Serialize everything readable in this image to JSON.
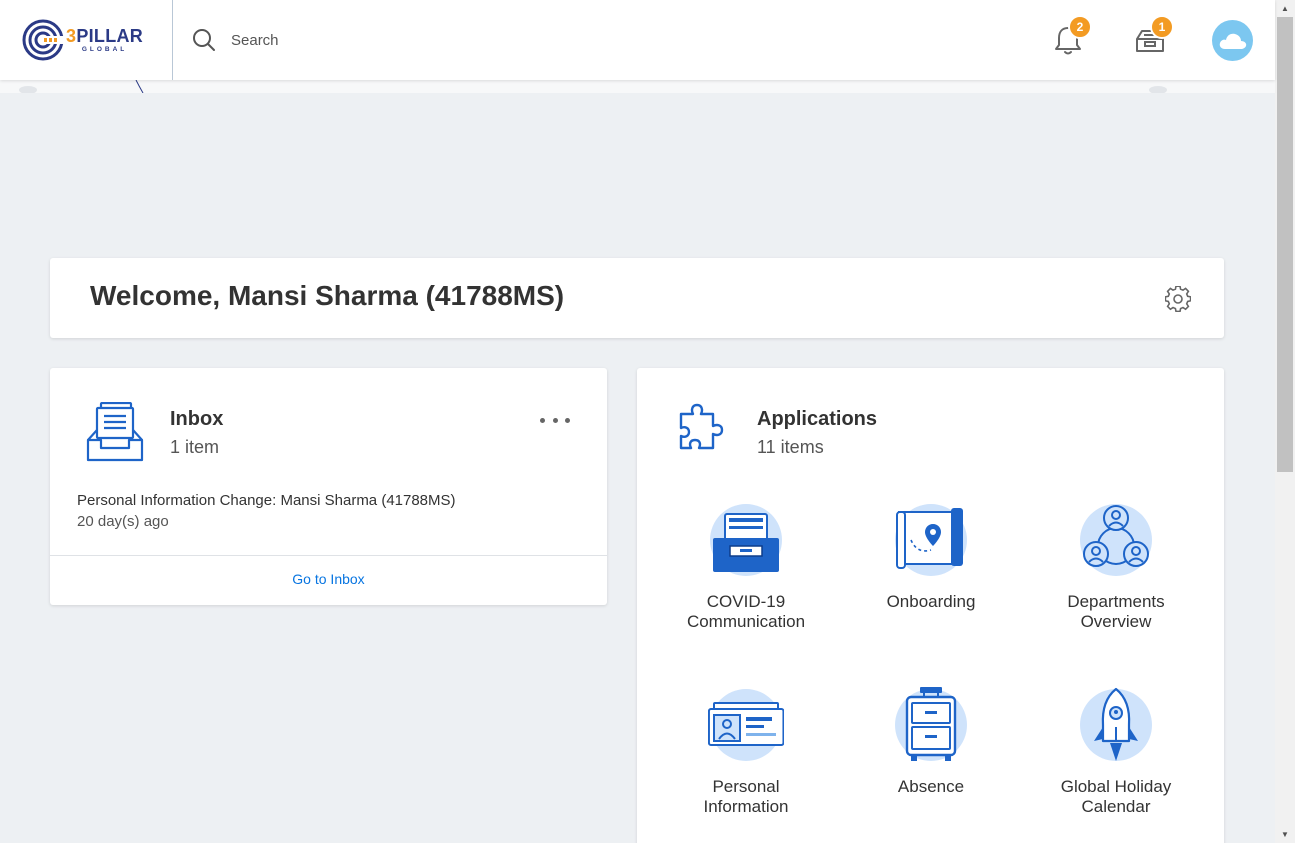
{
  "header": {
    "logo": {
      "main": "PILLAR",
      "prefix": "3",
      "sub": "GLOBAL"
    },
    "search_placeholder": "Search",
    "notifications": {
      "icon": "bell-icon",
      "count": "2"
    },
    "inbox": {
      "icon": "inbox-tray-icon",
      "count": "1"
    },
    "avatar_icon": "cloud-icon"
  },
  "welcome": {
    "title": "Welcome, Mansi Sharma (41788MS)",
    "settings_icon": "gear-icon"
  },
  "inbox_card": {
    "title": "Inbox",
    "count": "1 item",
    "item_title": "Personal Information Change: Mansi Sharma (41788MS)",
    "item_time": "20 day(s) ago",
    "link": "Go to Inbox"
  },
  "applications": {
    "title": "Applications",
    "count": "11 items",
    "apps": [
      {
        "line1": "COVID-19",
        "line2": "Communication",
        "icon": "file-cabinet-icon"
      },
      {
        "line1": "Onboarding",
        "line2": "",
        "icon": "map-pin-icon"
      },
      {
        "line1": "Departments",
        "line2": "Overview",
        "icon": "people-network-icon"
      },
      {
        "line1": "Personal",
        "line2": "Information",
        "icon": "id-card-icon"
      },
      {
        "line1": "Absence",
        "line2": "",
        "icon": "suitcase-icon"
      },
      {
        "line1": "Global Holiday",
        "line2": "Calendar",
        "icon": "rocket-icon"
      }
    ]
  },
  "colors": {
    "brand_navy": "#2b3a86",
    "brand_orange": "#f39b23",
    "accent_blue": "#0875e1",
    "icon_blue": "#1e64c8",
    "icon_light": "#cfe3fb",
    "background": "#edf0f3"
  }
}
